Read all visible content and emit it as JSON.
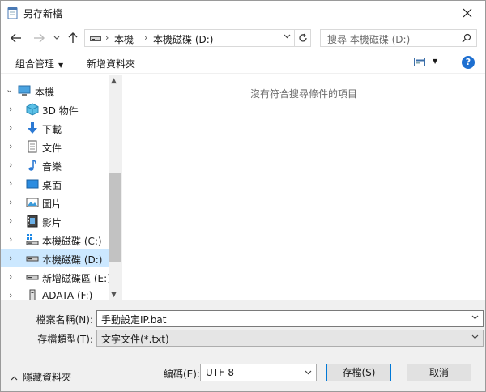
{
  "window": {
    "title": "另存新檔"
  },
  "address": {
    "crumbs": [
      "本機",
      "本機磁碟 (D:)"
    ]
  },
  "search": {
    "placeholder": "搜尋 本機磁碟 (D:)"
  },
  "toolbar": {
    "organize": "組合管理",
    "new_folder": "新增資料夾"
  },
  "tree": [
    {
      "label": "本機",
      "icon": "computer-icon",
      "expanded": true
    },
    {
      "label": "3D 物件",
      "icon": "3d-objects-icon"
    },
    {
      "label": "下載",
      "icon": "download-icon"
    },
    {
      "label": "文件",
      "icon": "document-icon"
    },
    {
      "label": "音樂",
      "icon": "music-icon"
    },
    {
      "label": "桌面",
      "icon": "desktop-icon"
    },
    {
      "label": "圖片",
      "icon": "picture-icon"
    },
    {
      "label": "影片",
      "icon": "video-icon"
    },
    {
      "label": "本機磁碟 (C:)",
      "icon": "windows-drive-icon"
    },
    {
      "label": "本機磁碟 (D:)",
      "icon": "drive-icon",
      "selected": true
    },
    {
      "label": "新增磁碟區 (E:)",
      "icon": "drive-icon"
    },
    {
      "label": "ADATA (F:)",
      "icon": "usb-drive-icon"
    }
  ],
  "content": {
    "empty_message": "沒有符合搜尋條件的項目"
  },
  "form": {
    "filename_label": "檔案名稱(N):",
    "filename_value": "手動設定IP.bat",
    "filetype_label": "存檔類型(T):",
    "filetype_value": "文字文件(*.txt)",
    "encoding_label": "編碼(E):",
    "encoding_value": "UTF-8"
  },
  "buttons": {
    "save": "存檔(S)",
    "cancel": "取消",
    "hide_folders": "隱藏資料夾"
  },
  "colors": {
    "selection": "#cce8ff",
    "accent": "#0078d7",
    "help": "#1e6fd0"
  }
}
